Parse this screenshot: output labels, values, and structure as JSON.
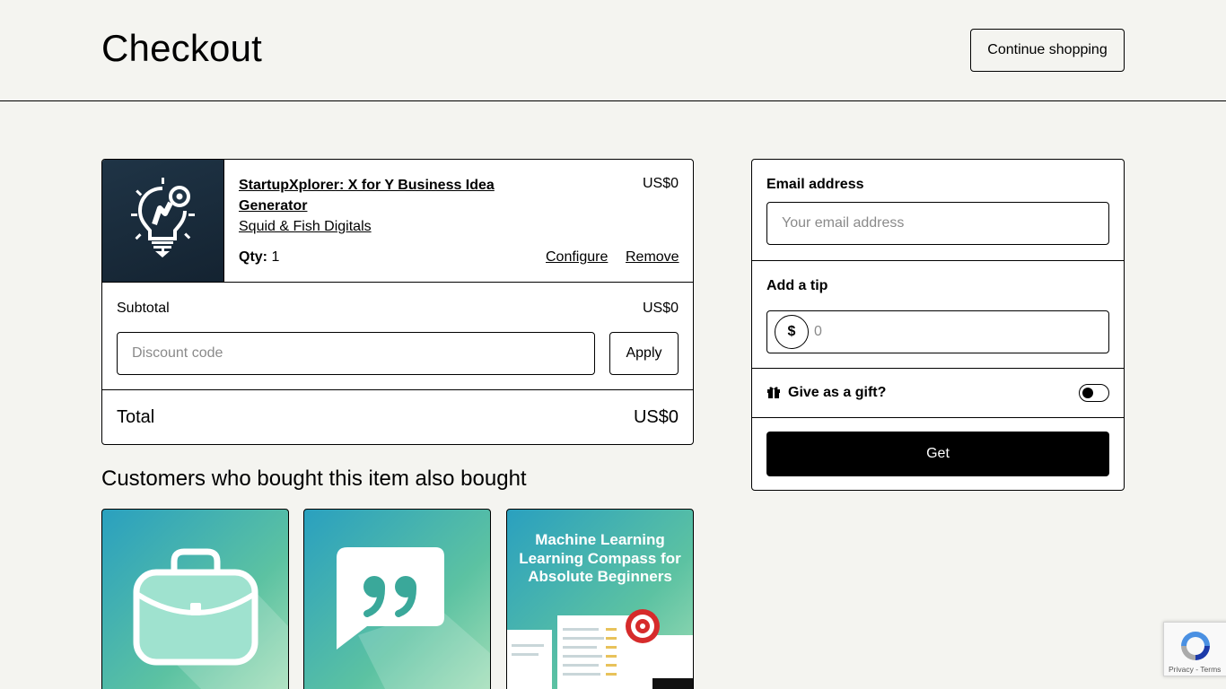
{
  "header": {
    "title": "Checkout",
    "continue_label": "Continue shopping"
  },
  "cart": {
    "item": {
      "title": "StartupXplorer: X for Y Business Idea Generator",
      "seller": "Squid & Fish Digitals",
      "price": "US$0",
      "qty_label": "Qty:",
      "qty_value": "1",
      "configure_label": "Configure",
      "remove_label": "Remove",
      "thumbnail_icon": "lightbulb-gear-icon"
    },
    "subtotal_label": "Subtotal",
    "subtotal_value": "US$0",
    "discount_placeholder": "Discount code",
    "apply_label": "Apply",
    "total_label": "Total",
    "total_value": "US$0"
  },
  "also_bought": {
    "heading": "Customers who bought this item also bought",
    "cards": [
      {
        "icon": "briefcase-icon"
      },
      {
        "icon": "quote-icon"
      },
      {
        "text": "Machine Learning Learning Compass for Absolute Beginners"
      }
    ]
  },
  "checkout_panel": {
    "email_label": "Email address",
    "email_placeholder": "Your email address",
    "tip_label": "Add a tip",
    "tip_currency": "$",
    "tip_placeholder": "0",
    "gift_label": "Give as a gift?",
    "gift_enabled": false,
    "get_label": "Get"
  },
  "recaptcha": {
    "links": "Privacy - Terms"
  }
}
